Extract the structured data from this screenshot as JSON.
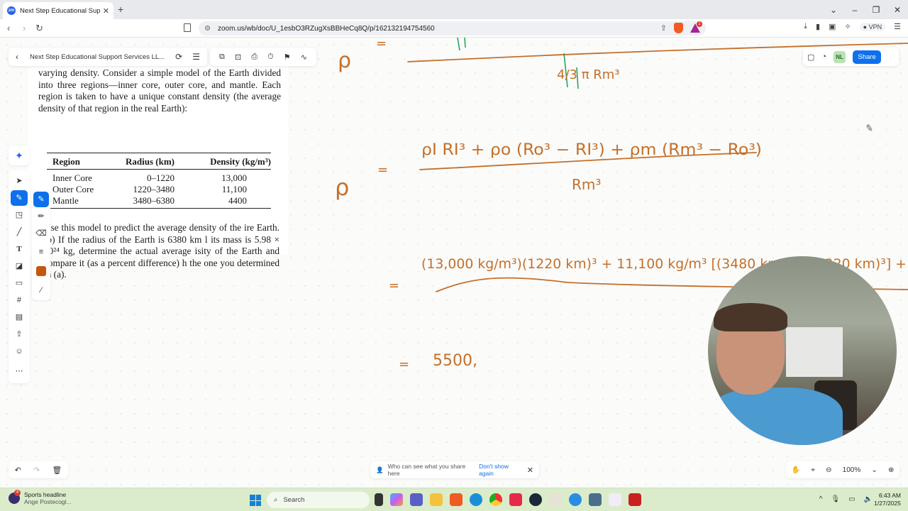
{
  "browser": {
    "tab_title": "Next Step Educational Support",
    "tab_favicon": "zoom-icon",
    "url": "zoom.us/wb/doc/U_1esbO3RZugXsBBHeCq8Q/p/162132194754560",
    "vpn_label": "VPN",
    "rewards_badge": "1"
  },
  "whiteboard": {
    "doc_name": "Next Step Educational Support Services LL...",
    "share_label": "Share",
    "avatar_initials": "NL",
    "zoom_level": "100%",
    "pen_color": "#c4570a",
    "ink_color": "#c4702a",
    "toast": {
      "text": "Who can see what you share here",
      "link": "Don't show again"
    }
  },
  "textbook": {
    "intro": "varying density. Consider a simple model of the Earth divided into three regions—inner core, outer core, and mantle. Each region is taken to have a unique constant density (the average density of that region in the real Earth):",
    "table": {
      "headers": [
        "Region",
        "Radius (km)",
        "Density (kg/m³)"
      ],
      "rows": [
        [
          "Inner Core",
          "0–1220",
          "13,000"
        ],
        [
          "Outer Core",
          "1220–3480",
          "11,100"
        ],
        [
          "Mantle",
          "3480–6380",
          "4400"
        ]
      ]
    },
    "question": "Use this model to predict the average density of the ire Earth. (b) If the radius of the Earth is 6380 km l its mass is 5.98 × 10²⁴ kg, determine the actual average isity of the Earth and compare it (as a percent difference) h the one you determined in (a)."
  },
  "handwriting": {
    "line1_lhs": "ρ",
    "line1_eq": "=",
    "line1_denominator": "4/3 π Rm³",
    "line2_lhs": "ρ",
    "line2_eq": "=",
    "line2_numerator": "ρI RI³ + ρo (Ro³ − RI³) + ρm (Rm³ − Ro³)",
    "line2_denominator": "Rm³",
    "line3_eq": "=",
    "line3_numerator": "(13,000 kg/m³)(1220 km)³ + 11,100 kg/m³ [(3480 km)³ − (1220 km)³] +",
    "line4_eq": "=",
    "line4_value": "5500,"
  },
  "taskbar": {
    "weather_title": "Sports headline",
    "weather_sub": "Ange Postecogl...",
    "weather_badge": "4",
    "search_label": "Search",
    "time": "6:43 AM",
    "date": "1/27/2025"
  }
}
